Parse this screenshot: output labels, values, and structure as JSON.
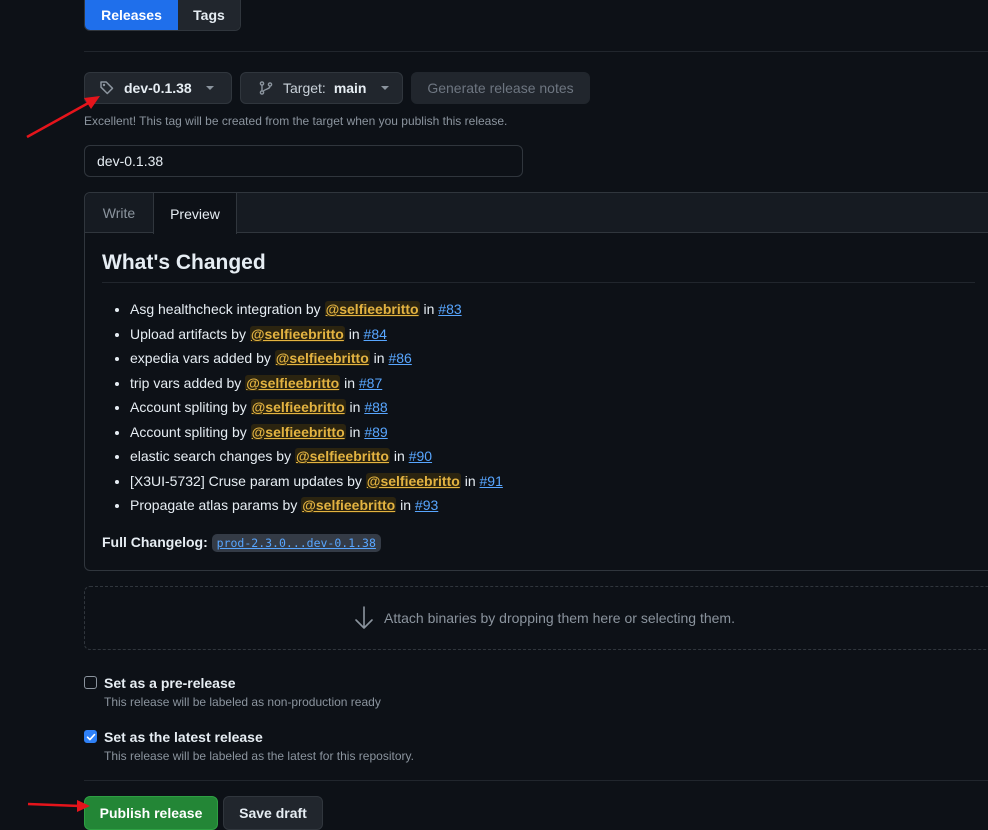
{
  "tabs": {
    "releases": "Releases",
    "tags": "Tags"
  },
  "tag_selector": {
    "value": "dev-0.1.38",
    "icon": "tag-icon"
  },
  "target_selector": {
    "label": "Target:",
    "value": "main",
    "icon": "branch-icon"
  },
  "generate_notes": "Generate release notes",
  "tag_hint": "Excellent! This tag will be created from the target when you publish this release.",
  "title_input": {
    "value": "dev-0.1.38"
  },
  "editor": {
    "write_tab": "Write",
    "preview_tab": "Preview",
    "heading": "What's Changed",
    "changes": [
      {
        "text": "Asg healthcheck integration by",
        "author": "@selfieebritto",
        "in": "in",
        "pr": "#83"
      },
      {
        "text": "Upload artifacts by",
        "author": "@selfieebritto",
        "in": "in",
        "pr": "#84"
      },
      {
        "text": "expedia vars added by",
        "author": "@selfieebritto",
        "in": "in",
        "pr": "#86"
      },
      {
        "text": "trip vars added by",
        "author": "@selfieebritto",
        "in": "in",
        "pr": "#87"
      },
      {
        "text": "Account spliting by",
        "author": "@selfieebritto",
        "in": "in",
        "pr": "#88"
      },
      {
        "text": "Account spliting by",
        "author": "@selfieebritto",
        "in": "in",
        "pr": "#89"
      },
      {
        "text": "elastic search changes by",
        "author": "@selfieebritto",
        "in": "in",
        "pr": "#90"
      },
      {
        "text": "[X3UI-5732] Cruse param updates by",
        "author": "@selfieebritto",
        "in": "in",
        "pr": "#91"
      },
      {
        "text": "Propagate atlas params by",
        "author": "@selfieebritto",
        "in": "in",
        "pr": "#93"
      }
    ],
    "changelog_label": "Full Changelog:",
    "changelog_link": "prod-2.3.0...dev-0.1.38"
  },
  "attach": {
    "text": "Attach binaries by dropping them here or selecting them.",
    "icon": "arrow-down-icon"
  },
  "prerelease": {
    "title": "Set as a pre-release",
    "desc": "This release will be labeled as non-production ready",
    "checked": false
  },
  "latest": {
    "title": "Set as the latest release",
    "desc": "This release will be labeled as the latest for this repository.",
    "checked": true
  },
  "actions": {
    "publish": "Publish release",
    "draft": "Save draft"
  },
  "colors": {
    "accent": "#1f6feb",
    "publish": "#238636",
    "annotation_arrow": "#e5141b",
    "mention": "#e3b341",
    "link": "#58a6ff"
  }
}
